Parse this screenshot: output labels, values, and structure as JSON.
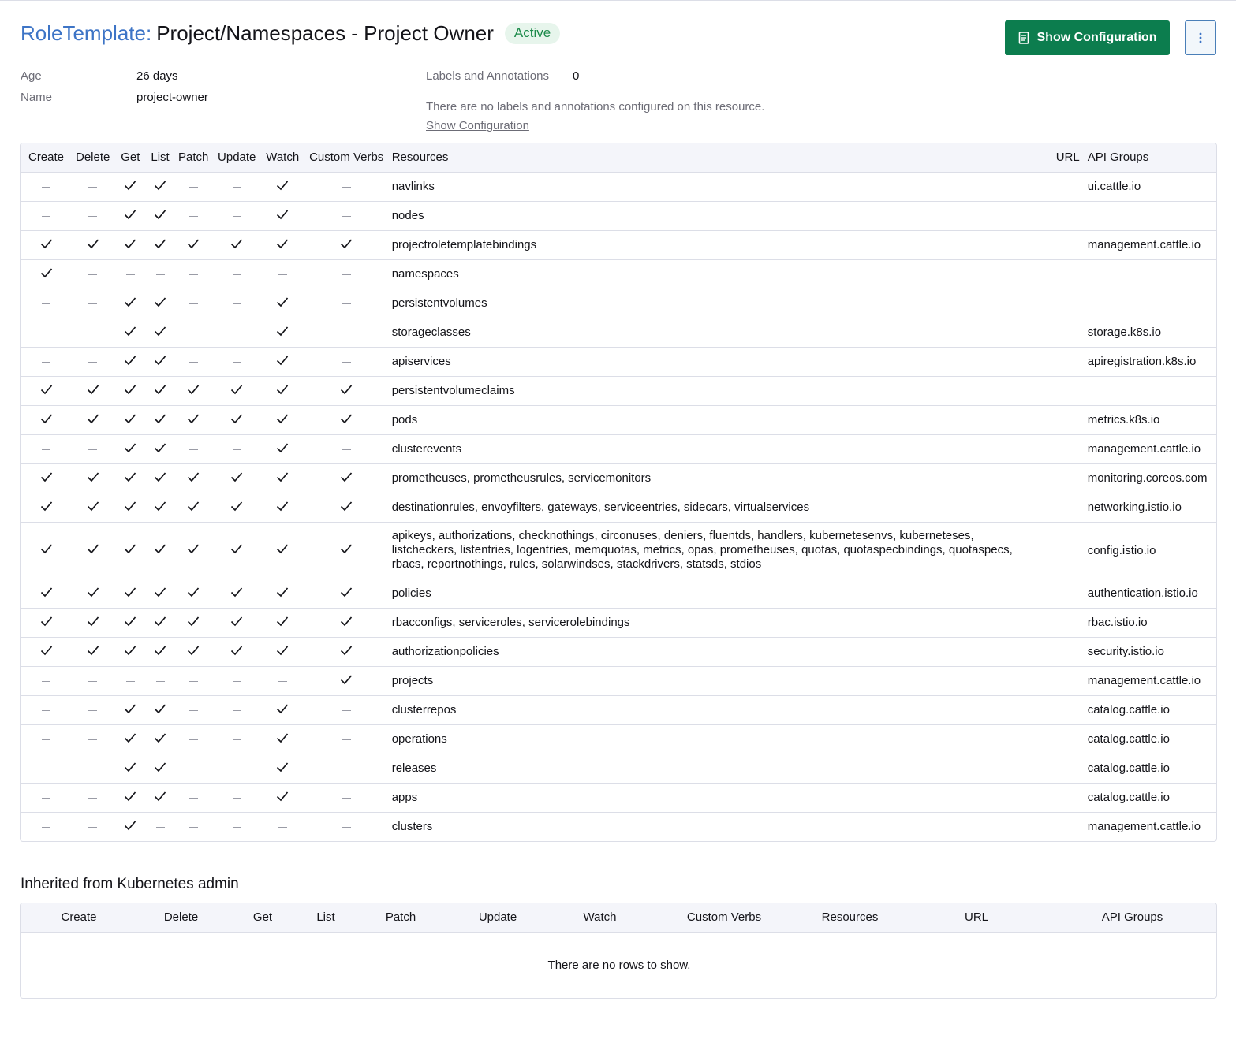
{
  "header": {
    "type_label": "RoleTemplate:",
    "title": "Project/Namespaces - Project Owner",
    "status": "Active",
    "show_config_label": "Show Configuration"
  },
  "details": {
    "age_label": "Age",
    "age_value": "26 days",
    "name_label": "Name",
    "name_value": "project-owner",
    "labels_label": "Labels and Annotations",
    "labels_count": "0",
    "labels_note": "There are no labels and annotations configured on this resource.",
    "show_config_link": "Show Configuration"
  },
  "rules_table": {
    "columns": [
      "Create",
      "Delete",
      "Get",
      "List",
      "Patch",
      "Update",
      "Watch",
      "Custom Verbs",
      "Resources",
      "URL",
      "API Groups"
    ],
    "rows": [
      {
        "verbs": [
          0,
          0,
          1,
          1,
          0,
          0,
          1,
          0
        ],
        "resources": "navlinks",
        "url": "",
        "api_groups": "ui.cattle.io"
      },
      {
        "verbs": [
          0,
          0,
          1,
          1,
          0,
          0,
          1,
          0
        ],
        "resources": "nodes",
        "url": "",
        "api_groups": ""
      },
      {
        "verbs": [
          1,
          1,
          1,
          1,
          1,
          1,
          1,
          1
        ],
        "resources": "projectroletemplatebindings",
        "url": "",
        "api_groups": "management.cattle.io"
      },
      {
        "verbs": [
          1,
          0,
          0,
          0,
          0,
          0,
          0,
          0
        ],
        "resources": "namespaces",
        "url": "",
        "api_groups": ""
      },
      {
        "verbs": [
          0,
          0,
          1,
          1,
          0,
          0,
          1,
          0
        ],
        "resources": "persistentvolumes",
        "url": "",
        "api_groups": ""
      },
      {
        "verbs": [
          0,
          0,
          1,
          1,
          0,
          0,
          1,
          0
        ],
        "resources": "storageclasses",
        "url": "",
        "api_groups": "storage.k8s.io"
      },
      {
        "verbs": [
          0,
          0,
          1,
          1,
          0,
          0,
          1,
          0
        ],
        "resources": "apiservices",
        "url": "",
        "api_groups": "apiregistration.k8s.io"
      },
      {
        "verbs": [
          1,
          1,
          1,
          1,
          1,
          1,
          1,
          1
        ],
        "resources": "persistentvolumeclaims",
        "url": "",
        "api_groups": ""
      },
      {
        "verbs": [
          1,
          1,
          1,
          1,
          1,
          1,
          1,
          1
        ],
        "resources": "pods",
        "url": "",
        "api_groups": "metrics.k8s.io"
      },
      {
        "verbs": [
          0,
          0,
          1,
          1,
          0,
          0,
          1,
          0
        ],
        "resources": "clusterevents",
        "url": "",
        "api_groups": "management.cattle.io"
      },
      {
        "verbs": [
          1,
          1,
          1,
          1,
          1,
          1,
          1,
          1
        ],
        "resources": "prometheuses, prometheusrules, servicemonitors",
        "url": "",
        "api_groups": "monitoring.coreos.com"
      },
      {
        "verbs": [
          1,
          1,
          1,
          1,
          1,
          1,
          1,
          1
        ],
        "resources": "destinationrules, envoyfilters, gateways, serviceentries, sidecars, virtualservices",
        "url": "",
        "api_groups": "networking.istio.io"
      },
      {
        "verbs": [
          1,
          1,
          1,
          1,
          1,
          1,
          1,
          1
        ],
        "resources": "apikeys, authorizations, checknothings, circonuses, deniers, fluentds, handlers, kubernetesenvs, kuberneteses, listcheckers, listentries, logentries, memquotas, metrics, opas, prometheuses, quotas, quotaspecbindings, quotaspecs, rbacs, reportnothings, rules, solarwindses, stackdrivers, statsds, stdios",
        "url": "",
        "api_groups": "config.istio.io"
      },
      {
        "verbs": [
          1,
          1,
          1,
          1,
          1,
          1,
          1,
          1
        ],
        "resources": "policies",
        "url": "",
        "api_groups": "authentication.istio.io"
      },
      {
        "verbs": [
          1,
          1,
          1,
          1,
          1,
          1,
          1,
          1
        ],
        "resources": "rbacconfigs, serviceroles, servicerolebindings",
        "url": "",
        "api_groups": "rbac.istio.io"
      },
      {
        "verbs": [
          1,
          1,
          1,
          1,
          1,
          1,
          1,
          1
        ],
        "resources": "authorizationpolicies",
        "url": "",
        "api_groups": "security.istio.io"
      },
      {
        "verbs": [
          0,
          0,
          0,
          0,
          0,
          0,
          0,
          1
        ],
        "resources": "projects",
        "url": "",
        "api_groups": "management.cattle.io"
      },
      {
        "verbs": [
          0,
          0,
          1,
          1,
          0,
          0,
          1,
          0
        ],
        "resources": "clusterrepos",
        "url": "",
        "api_groups": "catalog.cattle.io"
      },
      {
        "verbs": [
          0,
          0,
          1,
          1,
          0,
          0,
          1,
          0
        ],
        "resources": "operations",
        "url": "",
        "api_groups": "catalog.cattle.io"
      },
      {
        "verbs": [
          0,
          0,
          1,
          1,
          0,
          0,
          1,
          0
        ],
        "resources": "releases",
        "url": "",
        "api_groups": "catalog.cattle.io"
      },
      {
        "verbs": [
          0,
          0,
          1,
          1,
          0,
          0,
          1,
          0
        ],
        "resources": "apps",
        "url": "",
        "api_groups": "catalog.cattle.io"
      },
      {
        "verbs": [
          0,
          0,
          1,
          0,
          0,
          0,
          0,
          0
        ],
        "resources": "clusters",
        "url": "",
        "api_groups": "management.cattle.io"
      }
    ]
  },
  "inherited": {
    "title": "Inherited from Kubernetes admin",
    "columns": [
      "Create",
      "Delete",
      "Get",
      "List",
      "Patch",
      "Update",
      "Watch",
      "Custom Verbs",
      "Resources",
      "URL",
      "API Groups"
    ],
    "empty_text": "There are no rows to show."
  },
  "colors": {
    "accent_blue": "#3d74c6",
    "primary_green": "#0c7d4e",
    "status_green": "#1c8a4a"
  },
  "icons": {
    "checkmark": "check-icon",
    "dash": "dash-icon",
    "document": "document-icon",
    "kebab": "vertical-ellipsis-icon"
  }
}
